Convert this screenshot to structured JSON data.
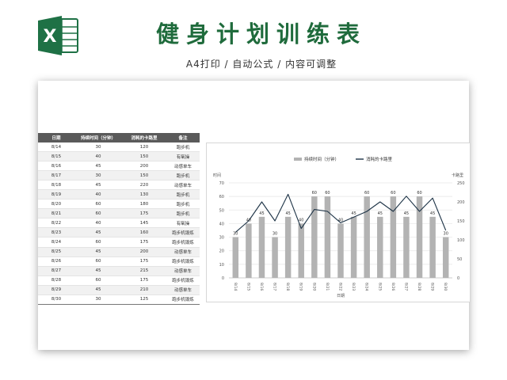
{
  "header": {
    "app_icon": "excel-icon",
    "title": "健身计划训练表",
    "subtitle": "A4打印 / 自动公式 / 内容可调整"
  },
  "table": {
    "headers": [
      "日期",
      "持续时间（分钟）",
      "消耗的卡路里",
      "备注"
    ],
    "rows": [
      [
        "8/14",
        "30",
        "120",
        "跑步机"
      ],
      [
        "8/15",
        "40",
        "150",
        "有氧操"
      ],
      [
        "8/16",
        "45",
        "200",
        "动感单车"
      ],
      [
        "8/17",
        "30",
        "150",
        "跑步机"
      ],
      [
        "8/18",
        "45",
        "220",
        "动感单车"
      ],
      [
        "8/19",
        "40",
        "130",
        "跑步机"
      ],
      [
        "8/20",
        "60",
        "180",
        "跑步机"
      ],
      [
        "8/21",
        "60",
        "175",
        "跑步机"
      ],
      [
        "8/22",
        "40",
        "145",
        "有氧操"
      ],
      [
        "8/23",
        "45",
        "160",
        "跑步机锻炼"
      ],
      [
        "8/24",
        "60",
        "175",
        "跑步机锻炼"
      ],
      [
        "8/25",
        "45",
        "200",
        "动感单车"
      ],
      [
        "8/26",
        "60",
        "175",
        "跑步机锻炼"
      ],
      [
        "8/27",
        "45",
        "215",
        "动感单车"
      ],
      [
        "8/28",
        "60",
        "175",
        "跑步机锻炼"
      ],
      [
        "8/29",
        "45",
        "210",
        "动感单车"
      ],
      [
        "8/30",
        "30",
        "125",
        "跑步机锻炼"
      ]
    ]
  },
  "chart_data": {
    "type": "bar",
    "categories": [
      "8/14",
      "8/15",
      "8/16",
      "8/17",
      "8/18",
      "8/19",
      "8/20",
      "8/21",
      "8/22",
      "8/23",
      "8/24",
      "8/25",
      "8/26",
      "8/27",
      "8/28",
      "8/29",
      "8/30"
    ],
    "series": [
      {
        "name": "持续时间（分钟）",
        "type": "bar",
        "axis": "left",
        "color": "#b3b3b3",
        "values": [
          30,
          40,
          45,
          30,
          45,
          40,
          60,
          60,
          40,
          45,
          60,
          45,
          60,
          45,
          60,
          45,
          30
        ]
      },
      {
        "name": "消耗的卡路里",
        "type": "line",
        "axis": "right",
        "color": "#1d3346",
        "values": [
          120,
          150,
          200,
          150,
          220,
          130,
          180,
          175,
          145,
          160,
          175,
          200,
          175,
          215,
          175,
          210,
          125
        ]
      }
    ],
    "xlabel": "日期",
    "ylabel": "时间",
    "y2label": "卡路里",
    "ylim": [
      0,
      70
    ],
    "yticks": [
      0,
      10,
      20,
      30,
      40,
      50,
      60,
      70
    ],
    "y2lim": [
      0,
      250
    ],
    "y2ticks": [
      0,
      50,
      100,
      150,
      200,
      250
    ],
    "legend": "top",
    "grid": true
  }
}
